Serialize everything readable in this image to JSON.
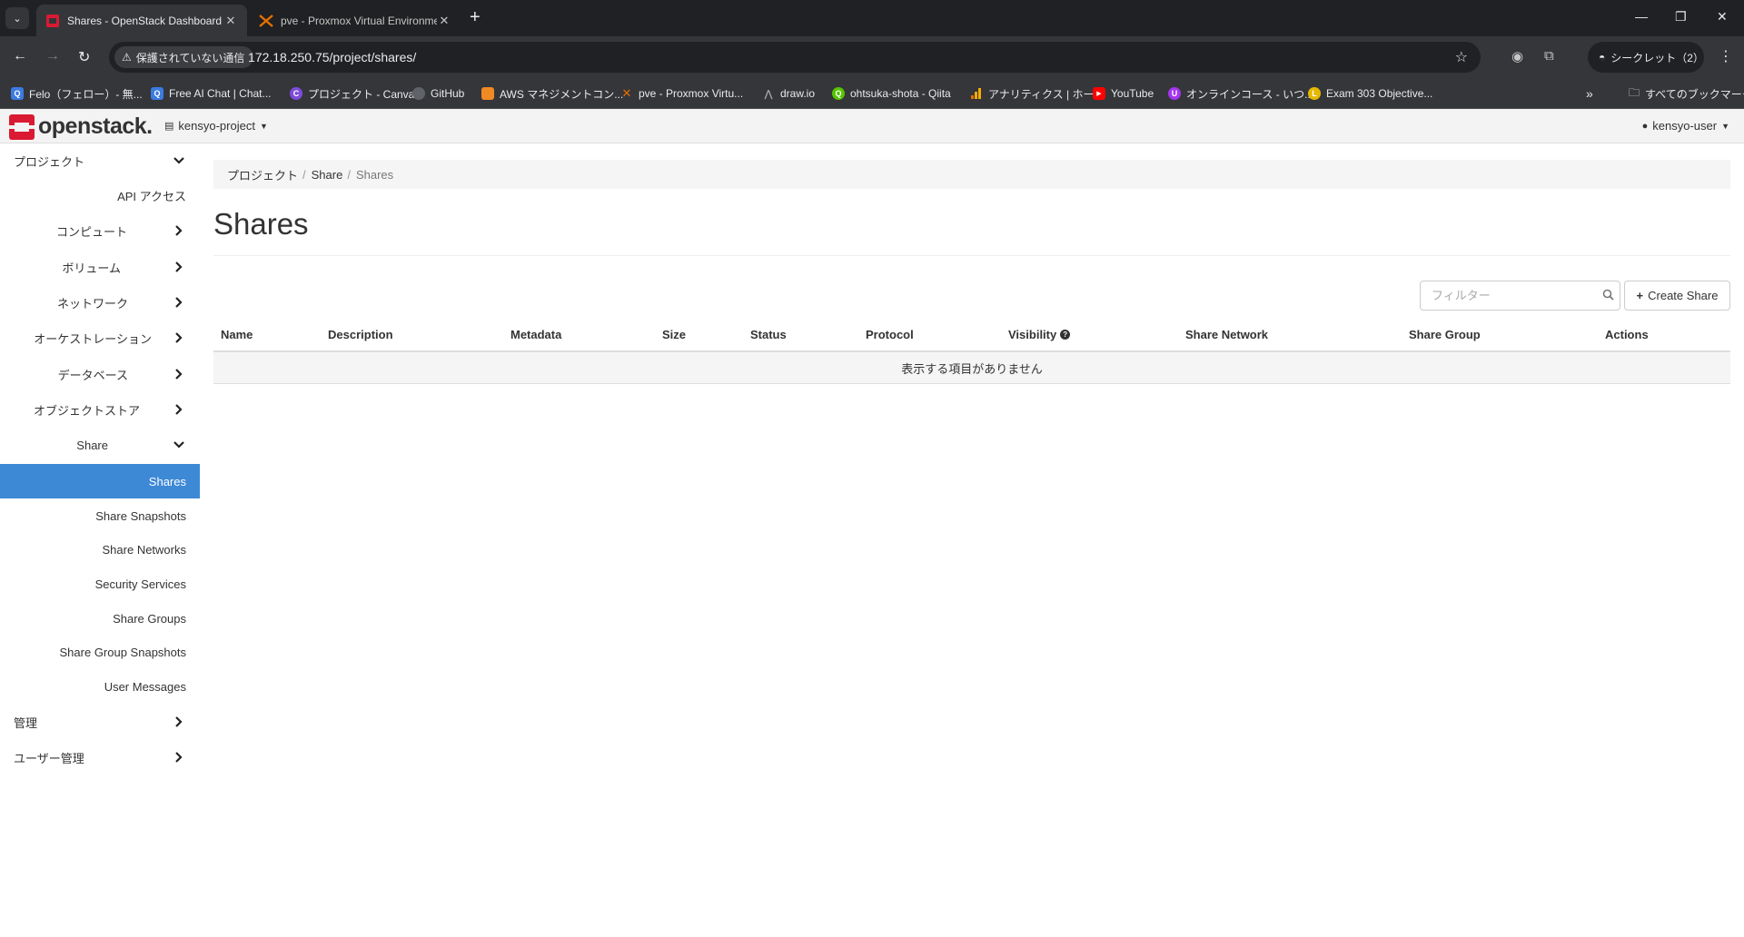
{
  "browser": {
    "tabs": [
      {
        "title": "Shares - OpenStack Dashboard",
        "active": true
      },
      {
        "title": "pve - Proxmox Virtual Environment",
        "active": false
      }
    ],
    "security_label": "保護されていない通信",
    "url": "172.18.250.75/project/shares/",
    "incognito_label": "シークレット（2）",
    "bookmarks": [
      {
        "label": "Felo（フェロー）- 無...",
        "color": "#3c7be0",
        "glyph": "Q"
      },
      {
        "label": "Free AI Chat | Chat...",
        "color": "#3c7be0",
        "glyph": "Q"
      },
      {
        "label": "プロジェクト - Canva",
        "color": "#7d4cdb",
        "glyph": "C"
      },
      {
        "label": "GitHub",
        "color": "#202124",
        "glyph": "●"
      },
      {
        "label": "AWS マネジメントコン...",
        "color": "#f08a24",
        "glyph": "⬢"
      },
      {
        "label": "pve - Proxmox Virtu...",
        "color": "#e57000",
        "glyph": "✕"
      },
      {
        "label": "draw.io",
        "color": "#888888",
        "glyph": "⋀"
      },
      {
        "label": "ohtsuka-shota - Qiita",
        "color": "#55c500",
        "glyph": "Q"
      },
      {
        "label": "アナリティクス | ホーム",
        "color": "#f9ab00",
        "glyph": "▮"
      },
      {
        "label": "YouTube",
        "color": "#ff0000",
        "glyph": "▶"
      },
      {
        "label": "オンラインコース - いつ...",
        "color": "#a435f0",
        "glyph": "U"
      },
      {
        "label": "Exam 303 Objective...",
        "color": "#e6b800",
        "glyph": "L"
      }
    ],
    "bookmarks_overflow": "»",
    "all_bookmarks_label": "すべてのブックマーク"
  },
  "navbar": {
    "brand": "openstack.",
    "project": "kensyo-project",
    "user": "kensyo-user"
  },
  "sidebar": {
    "project_label": "プロジェクト",
    "api_access": "API アクセス",
    "compute": "コンピュート",
    "volume": "ボリューム",
    "network": "ネットワーク",
    "orchestration": "オーケストレーション",
    "database": "データベース",
    "object_store": "オブジェクトストア",
    "share": "Share",
    "share_items": {
      "shares": "Shares",
      "share_snapshots": "Share Snapshots",
      "share_networks": "Share Networks",
      "security_services": "Security Services",
      "share_groups": "Share Groups",
      "share_group_snapshots": "Share Group Snapshots",
      "user_messages": "User Messages"
    },
    "admin": "管理",
    "identity": "ユーザー管理"
  },
  "breadcrumb": {
    "project": "プロジェクト",
    "share": "Share",
    "current": "Shares"
  },
  "page": {
    "title": "Shares",
    "filter_placeholder": "フィルター",
    "create_button": "Create Share"
  },
  "table": {
    "columns": {
      "name": "Name",
      "description": "Description",
      "metadata": "Metadata",
      "size": "Size",
      "status": "Status",
      "protocol": "Protocol",
      "visibility": "Visibility",
      "share_network": "Share Network",
      "share_group": "Share Group",
      "actions": "Actions"
    },
    "empty_message": "表示する項目がありません"
  }
}
